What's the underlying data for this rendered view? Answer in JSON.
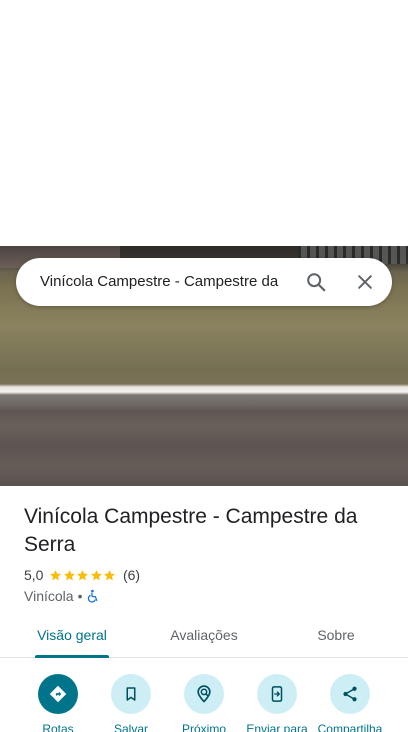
{
  "search": {
    "query": "Vinícola Campestre - Campestre da"
  },
  "place": {
    "title": "Vinícola Campestre - Campestre da Serra",
    "rating": "5,0",
    "stars": 5,
    "review_count": "(6)",
    "category": "Vinícola",
    "separator": "•",
    "accessibility_icon": "wheelchair-icon"
  },
  "tabs": [
    {
      "label": "Visão geral",
      "active": true
    },
    {
      "label": "Avaliações",
      "active": false
    },
    {
      "label": "Sobre",
      "active": false
    }
  ],
  "actions": [
    {
      "label": "Rotas",
      "icon": "directions-icon"
    },
    {
      "label": "Salvar",
      "icon": "bookmark-icon"
    },
    {
      "label": "Próximo",
      "icon": "nearby-icon"
    },
    {
      "label": "Enviar para",
      "icon": "send-to-phone-icon"
    },
    {
      "label": "Compartilha",
      "icon": "share-icon"
    }
  ],
  "colors": {
    "accent": "#00748a",
    "action_bg": "#cdeef5",
    "star": "#fbbc04",
    "accessibility": "#1a73e8"
  }
}
